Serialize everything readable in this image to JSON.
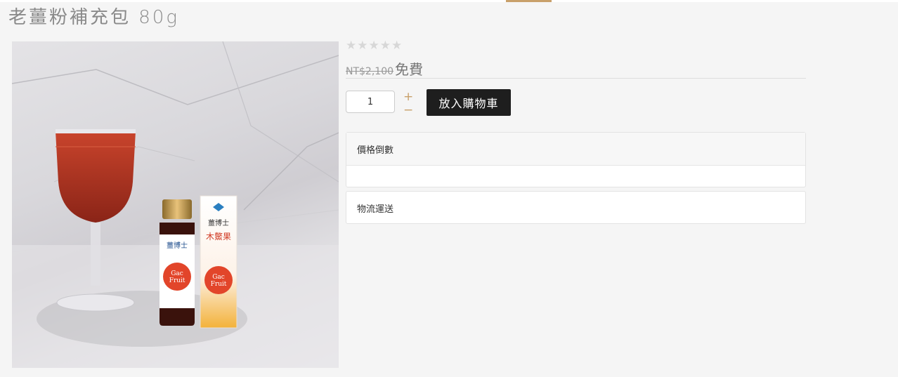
{
  "product": {
    "title": "老薑粉補充包 80g",
    "rating_stars": 0,
    "rating_max": 5,
    "price_original": "NT$2,100",
    "price_current": "免費"
  },
  "cart": {
    "quantity": "1",
    "plus_symbol": "+",
    "minus_symbol": "−",
    "add_to_cart_label": "放入購物車"
  },
  "panels": {
    "countdown_title": "價格倒數",
    "shipping_title": "物流運送"
  },
  "image_text": {
    "brand": "薑博士",
    "product_name": "木鱉果",
    "gac": "Gac",
    "fruit": "Fruit"
  },
  "colors": {
    "accent": "#c8a06a",
    "button_bg": "#1e1e1e",
    "star_empty": "#d7d7d7"
  }
}
